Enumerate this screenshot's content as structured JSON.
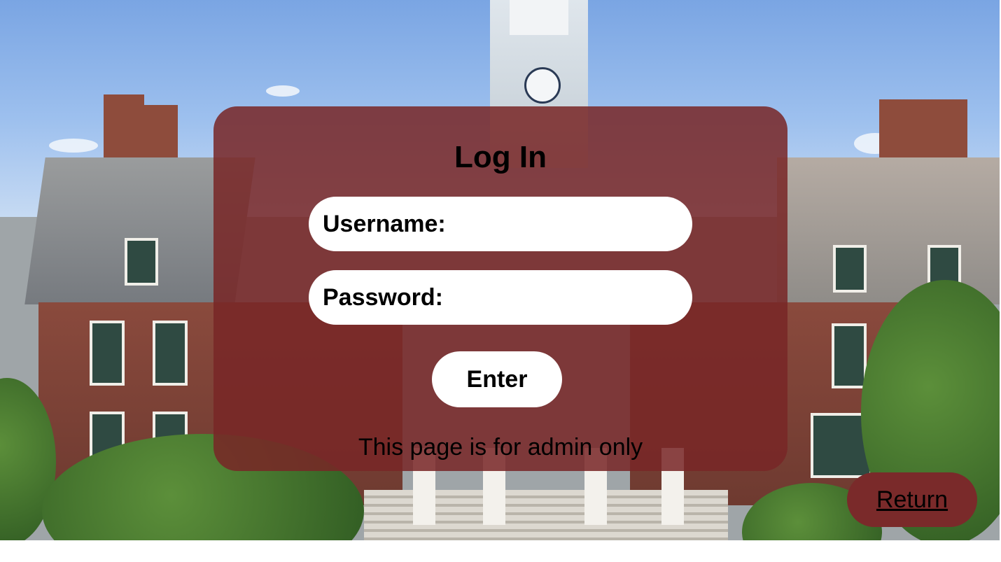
{
  "login": {
    "title": "Log In",
    "username_label": "Username:",
    "username_value": "",
    "password_label": "Password:",
    "password_value": "",
    "enter_label": "Enter",
    "note": "This page is for admin only"
  },
  "nav": {
    "return_label": "Return"
  },
  "colors": {
    "panel": "#7a2626",
    "return_button": "#7a2a2a",
    "field_bg": "#ffffff"
  }
}
